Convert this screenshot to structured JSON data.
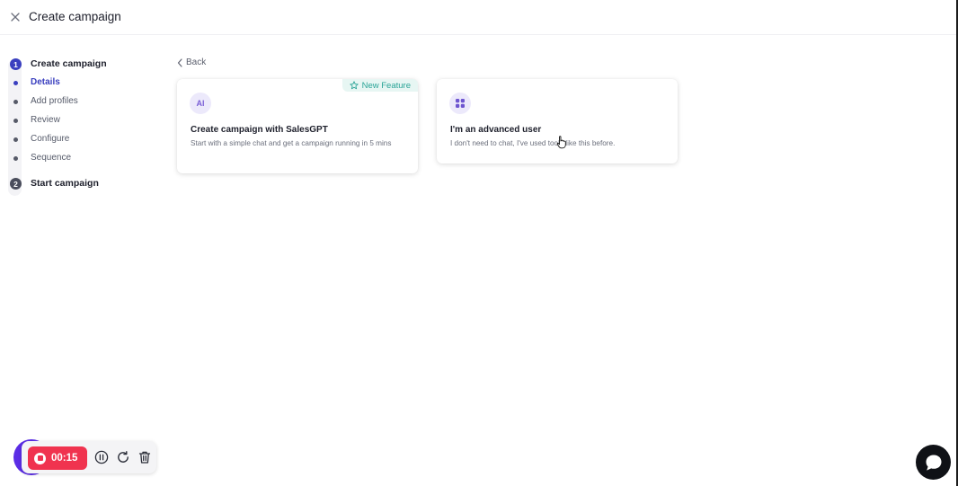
{
  "header": {
    "title": "Create campaign"
  },
  "stepper": {
    "step1": {
      "number": "1",
      "label": "Create campaign"
    },
    "substeps": [
      {
        "label": "Details",
        "active": true
      },
      {
        "label": "Add profiles",
        "active": false
      },
      {
        "label": "Review",
        "active": false
      },
      {
        "label": "Configure",
        "active": false
      },
      {
        "label": "Sequence",
        "active": false
      }
    ],
    "step2": {
      "number": "2",
      "label": "Start campaign"
    }
  },
  "back": {
    "label": "Back"
  },
  "cards": {
    "ai": {
      "icon_text": "AI",
      "badge": "New Feature",
      "title": "Create campaign with SalesGPT",
      "description": "Start with a simple chat and get a campaign running in 5 mins"
    },
    "advanced": {
      "icon": "grid-icon",
      "title": "I'm an advanced user",
      "description": "I don't need to chat, I've used tools like this before."
    }
  },
  "recorder": {
    "time": "00:15"
  },
  "colors": {
    "accent": "#3a3fbf",
    "badge_text": "#2aa497",
    "badge_bg": "#e7f6f3",
    "record_red": "#f0334f",
    "avatar_purple": "#5b2de6"
  }
}
